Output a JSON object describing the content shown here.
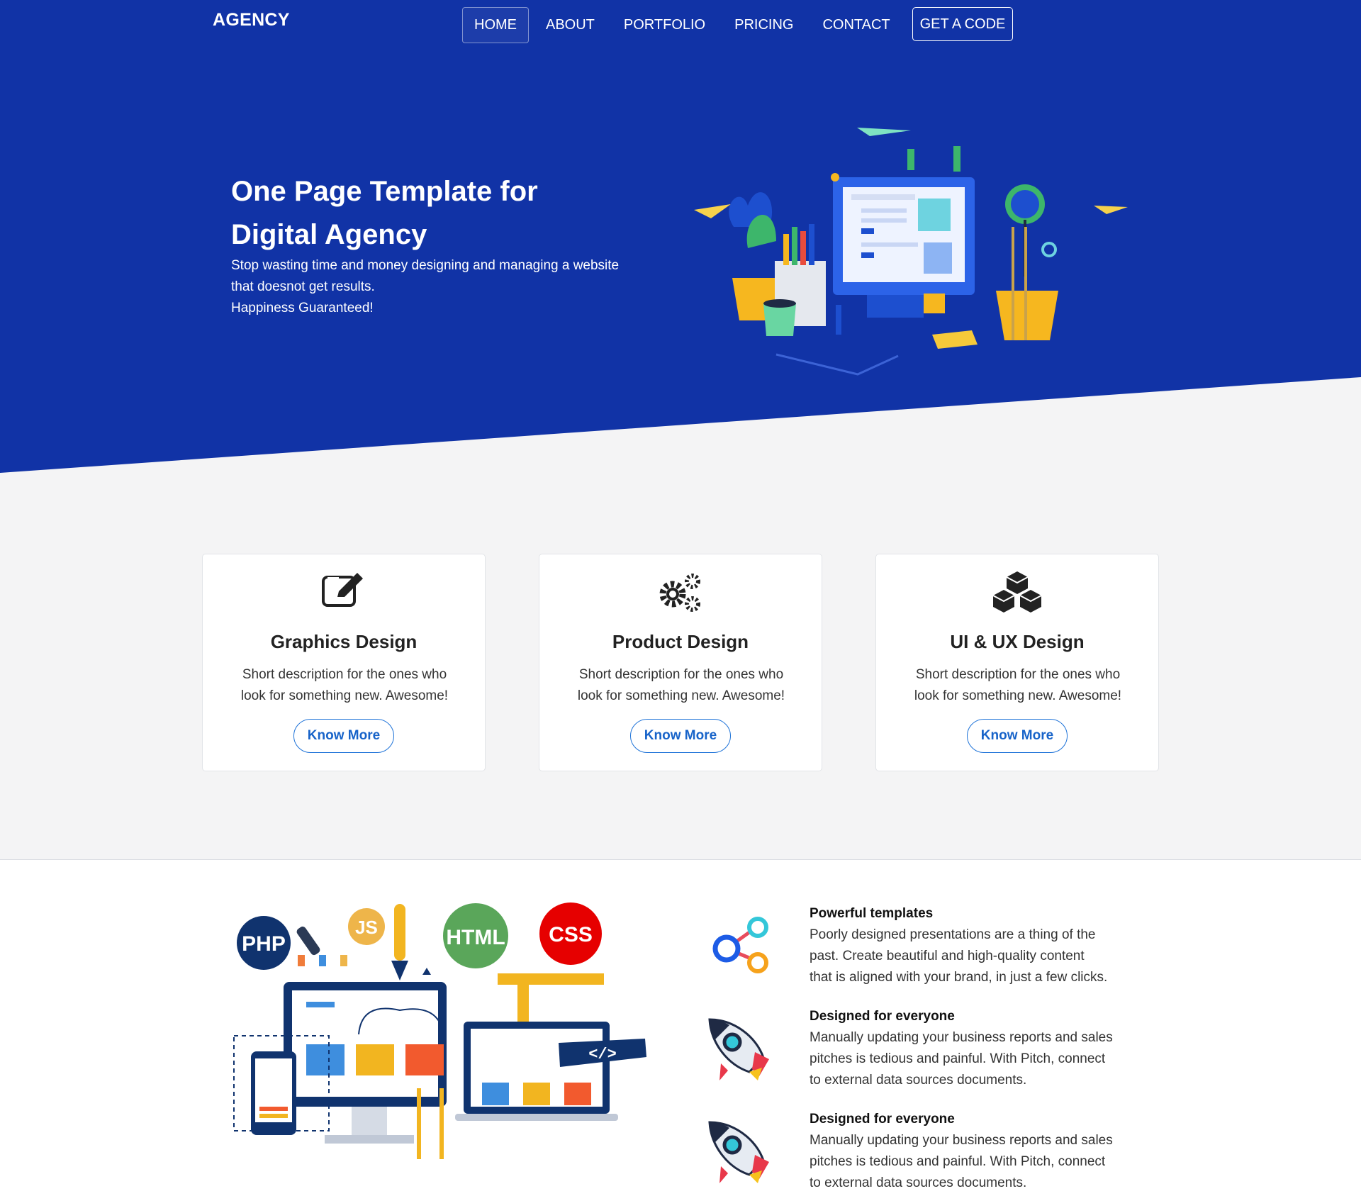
{
  "nav": {
    "brand": "AGENCY",
    "links": [
      "HOME",
      "ABOUT",
      "PORTFOLIO",
      "PRICING",
      "CONTACT"
    ],
    "cta": "GET A CODE"
  },
  "hero": {
    "title_line1": "One Page Template for",
    "title_line2": "Digital Agency",
    "desc_line1": "Stop wasting time and money designing and managing a website",
    "desc_line2": "that doesnot get results.",
    "desc_line3": "Happiness Guaranteed!"
  },
  "services": [
    {
      "title": "Graphics Design",
      "desc_line1": "Short description for the ones who",
      "desc_line2": "look for something new. Awesome!",
      "button": "Know More",
      "icon": "edit-icon"
    },
    {
      "title": "Product Design",
      "desc_line1": "Short description for the ones who",
      "desc_line2": "look for something new. Awesome!",
      "button": "Know More",
      "icon": "cogs-icon"
    },
    {
      "title": "UI & UX Design",
      "desc_line1": "Short description for the ones who",
      "desc_line2": "look for something new. Awesome!",
      "button": "Know More",
      "icon": "cubes-icon"
    }
  ],
  "illustration_badges": {
    "php": "PHP",
    "js": "JS",
    "html": "HTML",
    "css": "CSS",
    "code": "</>"
  },
  "features": [
    {
      "title": "Powerful templates",
      "lines": [
        "Poorly designed presentations are a thing of the",
        "past. Create beautiful and high-quality content",
        "that is aligned with your brand, in just a few clicks."
      ],
      "icon": "share-nodes-icon"
    },
    {
      "title": "Designed for everyone",
      "lines": [
        "Manually updating your business reports and sales",
        "pitches is tedious and painful. With Pitch, connect",
        "to external data sources documents."
      ],
      "icon": "rocket-icon"
    },
    {
      "title": "Designed for everyone",
      "lines": [
        "Manually updating your business reports and sales",
        "pitches is tedious and painful. With Pitch, connect",
        "to external data sources documents."
      ],
      "icon": "rocket-icon"
    }
  ],
  "colors": {
    "hero_blue": "#1133a6",
    "light_bg": "#f4f4f5",
    "button_blue": "#1763c9"
  }
}
